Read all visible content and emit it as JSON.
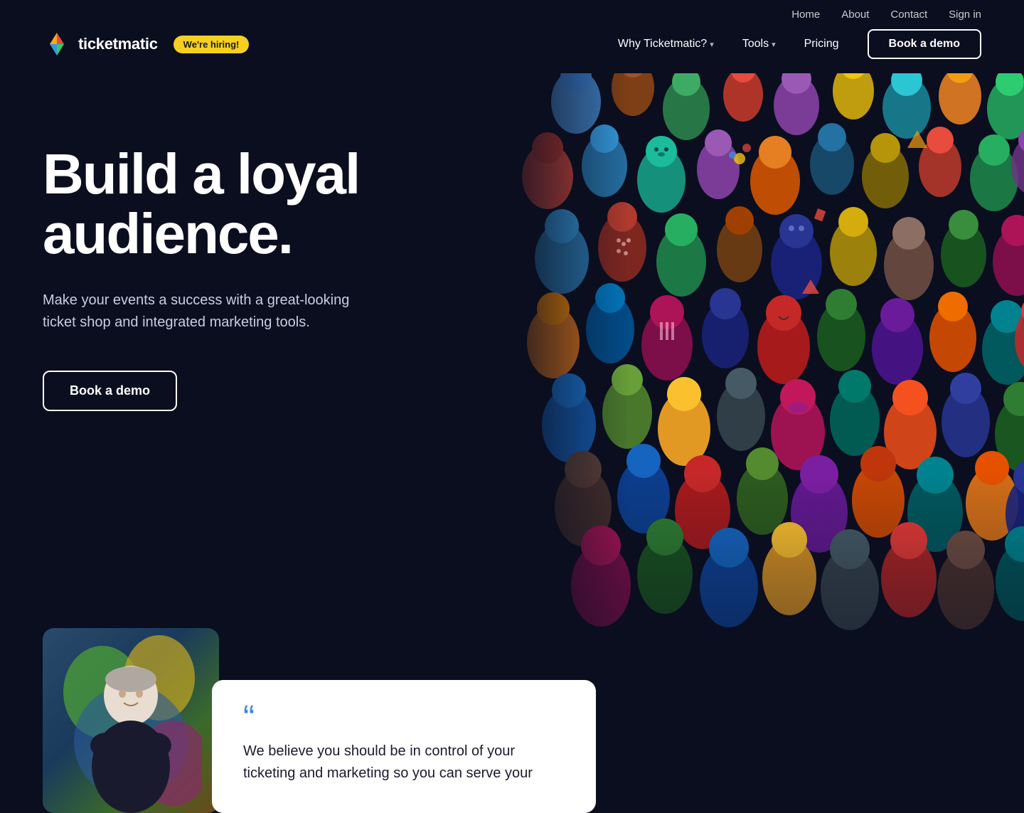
{
  "topbar": {
    "links": [
      "Home",
      "About",
      "Contact",
      "Sign in"
    ]
  },
  "nav": {
    "logo_text": "ticketmatic",
    "hiring_badge": "We're hiring!",
    "links": [
      {
        "label": "Why Ticketmatic?",
        "has_dropdown": true
      },
      {
        "label": "Tools",
        "has_dropdown": true
      },
      {
        "label": "Pricing",
        "has_dropdown": false
      }
    ],
    "cta": "Book a demo"
  },
  "hero": {
    "title": "Build a loyal audience.",
    "subtitle": "Make your events a success with a great-looking ticket shop and integrated marketing tools.",
    "cta": "Book a demo"
  },
  "testimonial": {
    "quote_mark": "“",
    "text": "We believe you should be in control of your ticketing and marketing so you can serve your"
  },
  "colors": {
    "bg": "#0a0e1f",
    "accent_blue": "#3b82f6",
    "badge_yellow": "#f5d020"
  }
}
